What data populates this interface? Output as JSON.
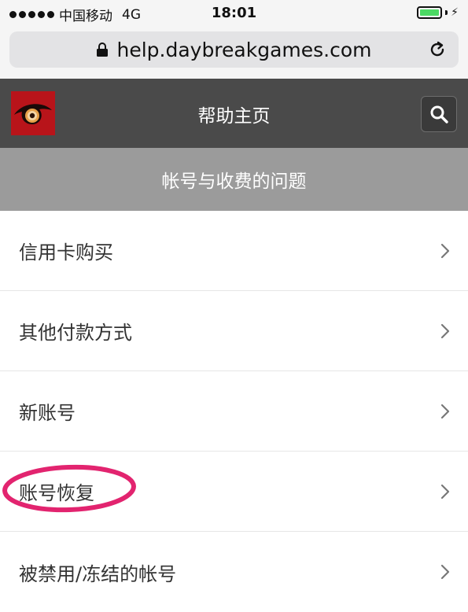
{
  "status_bar": {
    "carrier": "中国移动",
    "network": "4G",
    "time": "18:01",
    "battery_color": "#4cd964"
  },
  "browser": {
    "url": "help.daybreakgames.com",
    "lock_icon": "lock-icon",
    "reload_icon": "reload-icon"
  },
  "header": {
    "title": "帮助主页",
    "logo_icon": "eye-logo",
    "search_icon": "search-icon",
    "background": "#4a4a4a"
  },
  "category": {
    "title": "帐号与收费的问题",
    "background": "#9b9b9b"
  },
  "list": {
    "items": [
      {
        "label": "信用卡购买"
      },
      {
        "label": "其他付款方式"
      },
      {
        "label": "新账号"
      },
      {
        "label": "账号恢复",
        "highlighted": true,
        "highlight_color": "#e2246f"
      },
      {
        "label": "被禁用/冻结的帐号"
      }
    ]
  }
}
